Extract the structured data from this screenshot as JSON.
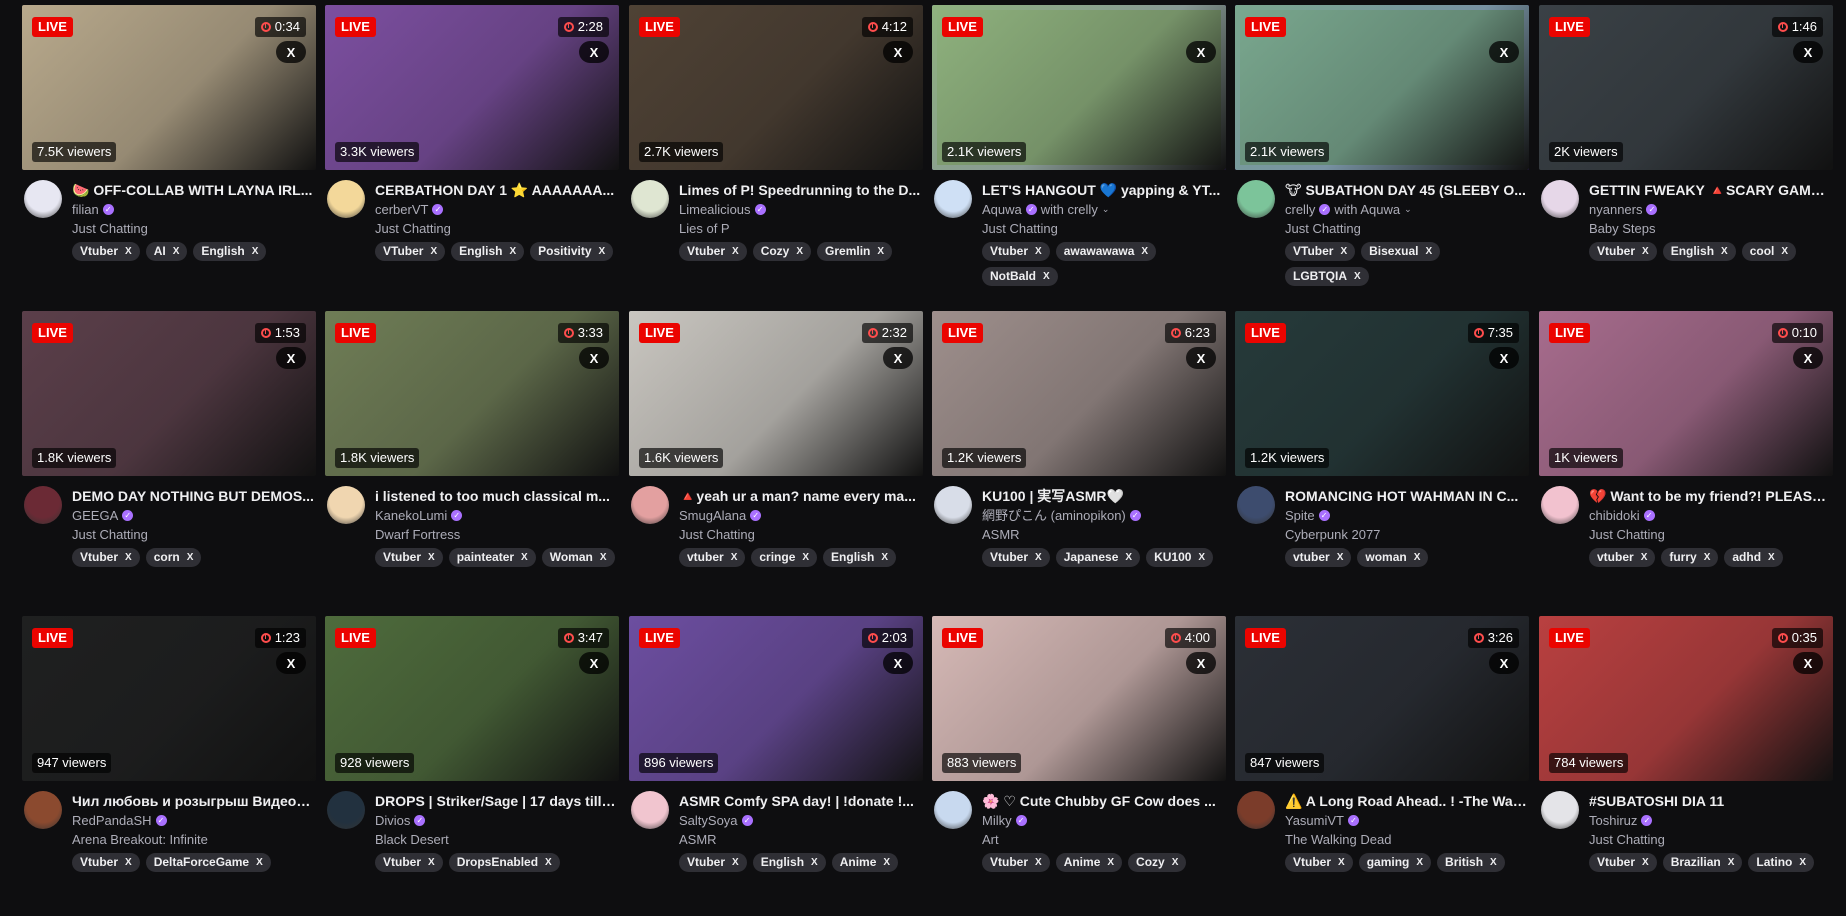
{
  "streams": [
    {
      "live": "LIVE",
      "uptime": "0:34",
      "viewers": "7.5K viewers",
      "title": "🍉 OFF-COLLAB WITH LAYNA IRL...",
      "channel": "filian",
      "collab": "",
      "category": "Just Chatting",
      "tags": [
        "Vtuber",
        "AI",
        "English"
      ],
      "bg": "#b8a98c",
      "avatar": "#e7e7f2"
    },
    {
      "live": "LIVE",
      "uptime": "2:28",
      "viewers": "3.3K viewers",
      "title": "CERBATHON DAY 1 ⭐ AAAAAAA...",
      "channel": "cerberVT",
      "collab": "",
      "category": "Just Chatting",
      "tags": [
        "VTuber",
        "English",
        "Positivity"
      ],
      "bg": "#7c4fa0",
      "avatar": "#f3d89a"
    },
    {
      "live": "LIVE",
      "uptime": "4:12",
      "viewers": "2.7K viewers",
      "title": "Limes of P! Speedrunning to the D...",
      "channel": "Limealicious",
      "collab": "",
      "category": "Lies of P",
      "tags": [
        "Vtuber",
        "Cozy",
        "Gremlin"
      ],
      "bg": "#4f4235",
      "avatar": "#dfe6d2"
    },
    {
      "live": "LIVE",
      "uptime": "",
      "viewers": "2.1K viewers",
      "title": "LET'S HANGOUT 💙 yapping & YT...",
      "channel": "Aquwa",
      "collab": "with crelly",
      "category": "Just Chatting",
      "tags": [
        "Vtuber",
        "awawawawa",
        "NotBald"
      ],
      "bg": "#8fb27e",
      "avatar": "#cfe0f5"
    },
    {
      "live": "LIVE",
      "uptime": "",
      "viewers": "2.1K viewers",
      "title": "🐮 SUBATHON DAY 45 (SLEEBY O...",
      "channel": "crelly",
      "collab": "with Aquwa",
      "category": "Just Chatting",
      "tags": [
        "VTuber",
        "Bisexual",
        "LGBTQIA"
      ],
      "bg": "#7aa88f",
      "avatar": "#7cc49a"
    },
    {
      "live": "LIVE",
      "uptime": "1:46",
      "viewers": "2K viewers",
      "title": "GETTIN FWEAKY 🔺SCARY GAME...",
      "channel": "nyanners",
      "collab": "",
      "category": "Baby Steps",
      "tags": [
        "Vtuber",
        "English",
        "cool"
      ],
      "bg": "#3a4146",
      "avatar": "#e6d7e8"
    },
    {
      "live": "LIVE",
      "uptime": "1:53",
      "viewers": "1.8K viewers",
      "title": "DEMO DAY NOTHING BUT DEMOS...",
      "channel": "GEEGA",
      "collab": "",
      "category": "Just Chatting",
      "tags": [
        "Vtuber",
        "corn"
      ],
      "bg": "#5b3f4a",
      "avatar": "#6b2a35"
    },
    {
      "live": "LIVE",
      "uptime": "3:33",
      "viewers": "1.8K viewers",
      "title": "i listened to too much classical m...",
      "channel": "KanekoLumi",
      "collab": "",
      "category": "Dwarf Fortress",
      "tags": [
        "Vtuber",
        "painteater",
        "Woman"
      ],
      "bg": "#6f7d56",
      "avatar": "#f0d6b0"
    },
    {
      "live": "LIVE",
      "uptime": "2:32",
      "viewers": "1.6K viewers",
      "title": "🔺yeah ur a man? name every ma...",
      "channel": "SmugAlana",
      "collab": "",
      "category": "Just Chatting",
      "tags": [
        "vtuber",
        "cringe",
        "English"
      ],
      "bg": "#c9c6c0",
      "avatar": "#e3a0a0"
    },
    {
      "live": "LIVE",
      "uptime": "6:23",
      "viewers": "1.2K viewers",
      "title": "KU100 | 実写ASMR🤍",
      "channel": "網野ぴこん (aminopikon)",
      "collab": "",
      "category": "ASMR",
      "tags": [
        "Vtuber",
        "Japanese",
        "KU100"
      ],
      "bg": "#9e8f8c",
      "avatar": "#d8dde8"
    },
    {
      "live": "LIVE",
      "uptime": "7:35",
      "viewers": "1.2K viewers",
      "title": "ROMANCING HOT WAHMAN IN C...",
      "channel": "Spite",
      "collab": "",
      "category": "Cyberpunk 2077",
      "tags": [
        "vtuber",
        "woman"
      ],
      "bg": "#263a3a",
      "avatar": "#3d4c6e"
    },
    {
      "live": "LIVE",
      "uptime": "0:10",
      "viewers": "1K viewers",
      "title": "💔 Want to be my friend?! PLEASE...",
      "channel": "chibidoki",
      "collab": "",
      "category": "Just Chatting",
      "tags": [
        "vtuber",
        "furry",
        "adhd"
      ],
      "bg": "#a76c8d",
      "avatar": "#f2c2cf"
    },
    {
      "live": "LIVE",
      "uptime": "1:23",
      "viewers": "947 viewers",
      "title": "Чил любовь и розыгрыш Видеок...",
      "channel": "RedPandaSH",
      "collab": "",
      "category": "Arena Breakout: Infinite",
      "tags": [
        "Vtuber",
        "DeltaForceGame"
      ],
      "bg": "#1f2020",
      "avatar": "#8b4a2f"
    },
    {
      "live": "LIVE",
      "uptime": "3:47",
      "viewers": "928 viewers",
      "title": "DROPS | Striker/Sage | 17 days till ...",
      "channel": "Divios",
      "collab": "",
      "category": "Black Desert",
      "tags": [
        "Vtuber",
        "DropsEnabled"
      ],
      "bg": "#4e6b3c",
      "avatar": "#22313f"
    },
    {
      "live": "LIVE",
      "uptime": "2:03",
      "viewers": "896 viewers",
      "title": "ASMR Comfy SPA day! | !donate !...",
      "channel": "SaltySoya",
      "collab": "",
      "category": "ASMR",
      "tags": [
        "Vtuber",
        "English",
        "Anime"
      ],
      "bg": "#6c4ea0",
      "avatar": "#f1c5cf"
    },
    {
      "live": "LIVE",
      "uptime": "4:00",
      "viewers": "883 viewers",
      "title": "🌸 ♡ Cute Chubby GF Cow does ...",
      "channel": "Milky",
      "collab": "",
      "category": "Art",
      "tags": [
        "Vtuber",
        "Anime",
        "Cozy"
      ],
      "bg": "#d6b9b6",
      "avatar": "#c8d9ef"
    },
    {
      "live": "LIVE",
      "uptime": "3:26",
      "viewers": "847 viewers",
      "title": "⚠️ A Long Road Ahead.. ! -The Wal...",
      "channel": "YasumiVT",
      "collab": "",
      "category": "The Walking Dead",
      "tags": [
        "Vtuber",
        "gaming",
        "British"
      ],
      "bg": "#2b2f36",
      "avatar": "#7b3c2a"
    },
    {
      "live": "LIVE",
      "uptime": "0:35",
      "viewers": "784 viewers",
      "title": "#SUBATOSHI DIA 11",
      "channel": "Toshiruz",
      "collab": "",
      "category": "Just Chatting",
      "tags": [
        "Vtuber",
        "Brazilian",
        "Latino"
      ],
      "bg": "#b94040",
      "avatar": "#e4e4e8"
    }
  ]
}
